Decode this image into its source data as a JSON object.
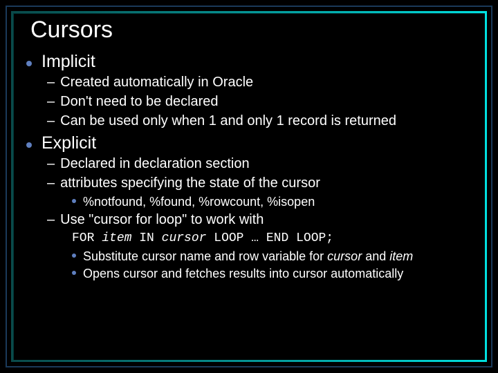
{
  "title": "Cursors",
  "sections": [
    {
      "heading": "Implicit",
      "subs": [
        {
          "text": "Created automatically in Oracle"
        },
        {
          "text": "Don't need to be declared"
        },
        {
          "text": "Can be used only when 1 and only 1 record is returned"
        }
      ]
    },
    {
      "heading": "Explicit",
      "subs": [
        {
          "text": "Declared in declaration section"
        },
        {
          "text": "attributes specifying the state of the cursor",
          "bullets": [
            {
              "text": "%notfound, %found, %rowcount, %isopen"
            }
          ]
        },
        {
          "text": "Use \"cursor for loop\" to work with",
          "code": "FOR item IN cursor LOOP … END LOOP;",
          "code_parts": {
            "for": "FOR ",
            "item": "item",
            "in": " IN ",
            "cursor": "cursor",
            "rest": " LOOP … END LOOP;"
          },
          "bullets": [
            {
              "pre": "Substitute cursor name and row variable for ",
              "em1": "cursor",
              "mid": " and ",
              "em2": "item"
            },
            {
              "text": "Opens cursor and fetches results into cursor automatically"
            }
          ]
        }
      ]
    }
  ]
}
